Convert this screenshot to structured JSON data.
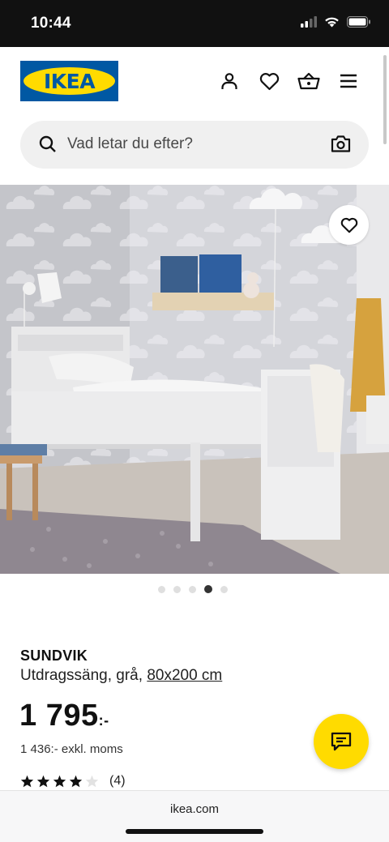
{
  "status_bar": {
    "time": "10:44"
  },
  "header": {
    "logo_text": "IKEA"
  },
  "search": {
    "placeholder": "Vad letar du efter?"
  },
  "carousel": {
    "total": 5,
    "active_index": 3
  },
  "product": {
    "name": "SUNDVIK",
    "description": "Utdragssäng, grå,",
    "size_link": "80x200 cm",
    "price_main": "1 795",
    "price_suffix": ":-",
    "price_ex_vat": "1 436:- exkl. moms",
    "rating_stars": 4,
    "rating_max": 5,
    "review_count": "(4)"
  },
  "browser": {
    "url": "ikea.com"
  },
  "colors": {
    "ikea_blue": "#0058a3",
    "ikea_yellow": "#ffdb00"
  },
  "icons": {
    "header": [
      "person-icon",
      "heart-icon",
      "basket-icon",
      "menu-icon"
    ],
    "search": [
      "search-icon",
      "camera-icon"
    ]
  }
}
